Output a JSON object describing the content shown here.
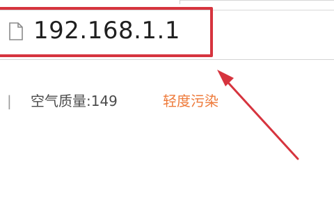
{
  "address_bar": {
    "url": "192.168.1.1",
    "page_icon": "blank-page-icon"
  },
  "status": {
    "separator": "|",
    "aqi_text": "空气质量:149",
    "aqi_status": "轻度污染"
  },
  "annotation": {
    "highlight_color": "#d6343e",
    "arrow_color": "#d6343e"
  },
  "colors": {
    "aqi_status": "#ee7a3a"
  }
}
